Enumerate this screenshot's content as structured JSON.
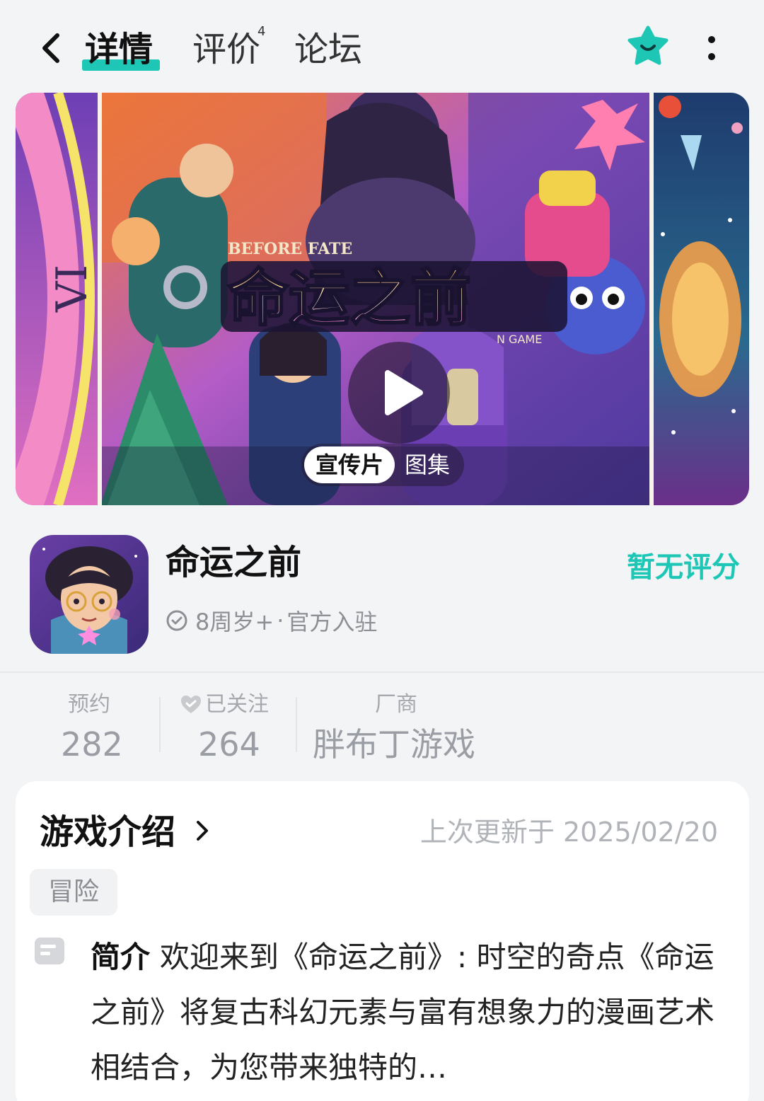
{
  "header": {
    "tabs": [
      {
        "label": "详情",
        "active": true
      },
      {
        "label": "评价",
        "badge": "4"
      },
      {
        "label": "论坛"
      }
    ],
    "accent_color": "#1ec7b5"
  },
  "banner": {
    "logo_subtitle": "BEFORE FATE",
    "logo_title": "命运之前",
    "logo_tag": "N GAME",
    "clock_numeral": "VI",
    "media_tabs": {
      "active": "宣传片",
      "other": "图集"
    }
  },
  "app": {
    "name": "命运之前",
    "rating": "暂无评分",
    "age": "8周岁+",
    "separator": "·",
    "official": "官方入驻"
  },
  "stats": {
    "reserve": {
      "label": "预约",
      "value": "282"
    },
    "follow": {
      "label": "已关注",
      "value": "264"
    },
    "vendor": {
      "label": "厂商",
      "value": "胖布丁游戏"
    }
  },
  "intro": {
    "title": "游戏介绍",
    "updated": "上次更新于 2025/02/20",
    "tag": "冒险",
    "desc_label": "简介",
    "desc_text": "欢迎来到《命运之前》: 时空的奇点《命运之前》将复古科幻元素与富有想象力的漫画艺术相结合，为您带来独特的…"
  }
}
